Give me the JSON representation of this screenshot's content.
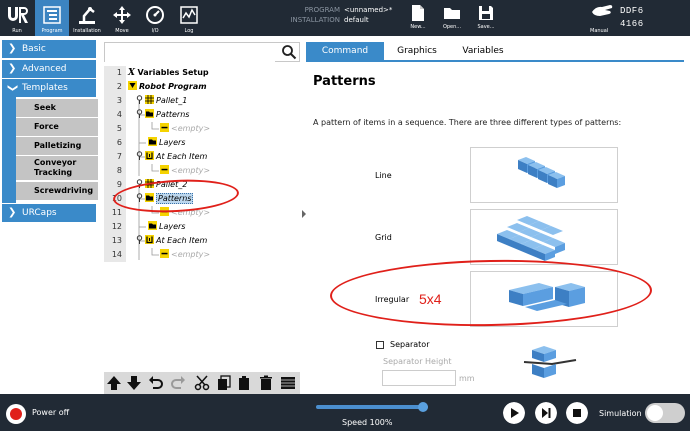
{
  "header": {
    "logo": "UR",
    "nav": [
      {
        "label": "Run",
        "icon": "ur-logo-icon"
      },
      {
        "label": "Program",
        "icon": "program-icon"
      },
      {
        "label": "Installation",
        "icon": "robot-arm-icon"
      },
      {
        "label": "Move",
        "icon": "move-arrows-icon"
      },
      {
        "label": "I/O",
        "icon": "io-gauge-icon"
      },
      {
        "label": "Log",
        "icon": "log-chart-icon"
      }
    ],
    "program_key": "PROGRAM",
    "program_val": "<unnamed>*",
    "installation_key": "INSTALLATION",
    "installation_val": "default",
    "file_buttons": [
      {
        "label": "New...",
        "icon": "new-file-icon"
      },
      {
        "label": "Open...",
        "icon": "open-folder-icon"
      },
      {
        "label": "Save...",
        "icon": "save-icon"
      }
    ],
    "manual_label": "Manual",
    "robot_id_line1": "DDF6",
    "robot_id_line2": "4166"
  },
  "sidebar": {
    "groups": [
      {
        "label": "Basic"
      },
      {
        "label": "Advanced"
      },
      {
        "label": "Templates"
      },
      {
        "label": "URCaps"
      }
    ],
    "template_items": [
      "Seek",
      "Force",
      "Palletizing",
      "Conveyor Tracking",
      "Screwdriving"
    ]
  },
  "tree": {
    "search_placeholder": "",
    "rows": [
      {
        "num": "1",
        "text": "Variables Setup"
      },
      {
        "num": "2",
        "text": "Robot Program"
      },
      {
        "num": "3",
        "text": "Pallet_1"
      },
      {
        "num": "4",
        "text": "Patterns"
      },
      {
        "num": "5",
        "text": "<empty>"
      },
      {
        "num": "6",
        "text": "Layers"
      },
      {
        "num": "7",
        "text": "At Each Item"
      },
      {
        "num": "8",
        "text": "<empty>"
      },
      {
        "num": "9",
        "text": "Pallet_2"
      },
      {
        "num": "10",
        "text": "Patterns"
      },
      {
        "num": "11",
        "text": "<empty>"
      },
      {
        "num": "12",
        "text": "Layers"
      },
      {
        "num": "13",
        "text": "At Each Item"
      },
      {
        "num": "14",
        "text": "<empty>"
      }
    ]
  },
  "panel": {
    "tabs": [
      "Command",
      "Graphics",
      "Variables"
    ],
    "title": "Patterns",
    "description": "A pattern of items in a sequence. There are three different types of patterns:",
    "patterns": [
      "Line",
      "Grid",
      "Irregular"
    ],
    "annotation_note": "5x4",
    "separator_label": "Separator",
    "separator_height_label": "Separator Height",
    "separator_height_value": "",
    "separator_height_unit": "mm"
  },
  "footer": {
    "power_label": "Power off",
    "speed_label": "Speed 100%",
    "speed_percent": 100,
    "simulation_label": "Simulation",
    "simulation_on": false
  },
  "colors": {
    "header_bg": "#212a35",
    "accent": "#3a8ac9",
    "annotation": "#e0201a",
    "cube_blue": "#4a90d6"
  }
}
